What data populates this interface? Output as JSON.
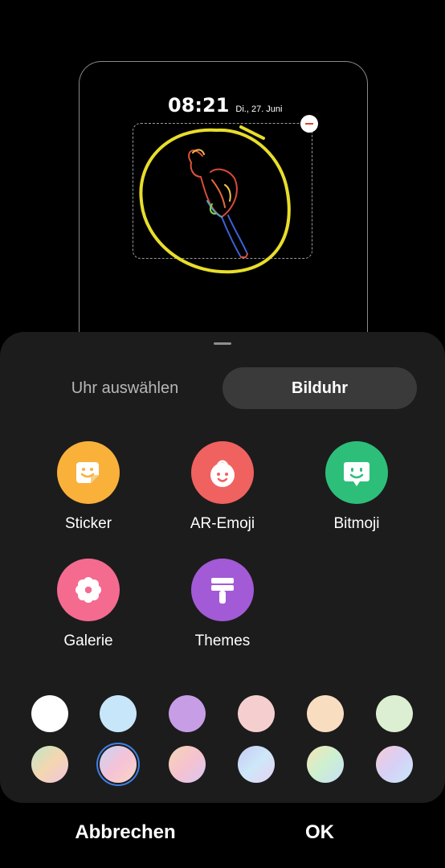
{
  "preview": {
    "time": "08:21",
    "date": "Di., 27. Juni"
  },
  "tabs": {
    "clock": "Uhr auswählen",
    "image_clock": "Bilduhr"
  },
  "options": [
    {
      "label": "Sticker",
      "color": "#f9b13a",
      "icon": "sticker-icon"
    },
    {
      "label": "AR-Emoji",
      "color": "#f0625f",
      "icon": "face-icon"
    },
    {
      "label": "Bitmoji",
      "color": "#2dbf7a",
      "icon": "bitmoji-icon"
    },
    {
      "label": "Galerie",
      "color": "#f46b8f",
      "icon": "flower-icon"
    },
    {
      "label": "Themes",
      "color": "#a35ad6",
      "icon": "brush-icon"
    }
  ],
  "swatches": {
    "row1": [
      "#ffffff",
      "#c8e6fa",
      "#c79de6",
      "#f5cfd0",
      "#f8ddc0",
      "#ddefd2"
    ],
    "row2": [
      "#cfe9c4",
      "#f7c4d4",
      "#f4c7b6",
      "#cfcff7",
      "#d8f5d2",
      "#e5d0f7"
    ],
    "selected_index_row2": 1
  },
  "footer": {
    "cancel": "Abbrechen",
    "ok": "OK"
  },
  "colors": {
    "sheet_background": "#1c1c1c",
    "highlight_circle": "#e8de2a",
    "selection_ring": "#3f7fe6"
  }
}
